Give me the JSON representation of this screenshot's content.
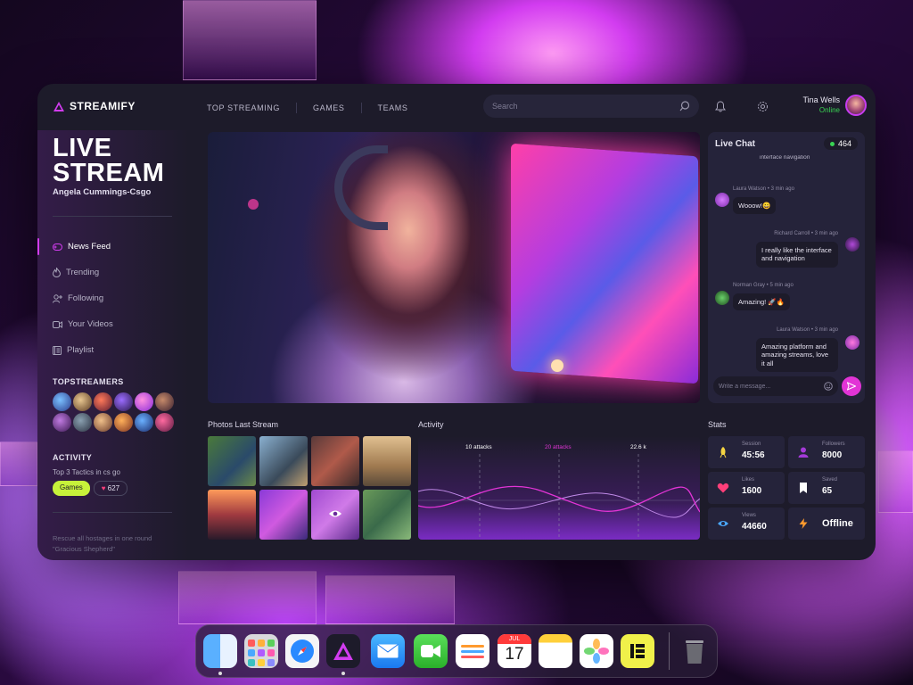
{
  "brand": {
    "name": "STREAMIFY",
    "accent": "#d23cf0"
  },
  "nav": {
    "items": [
      "TOP STREAMING",
      "GAMES",
      "TEAMS"
    ]
  },
  "search": {
    "placeholder": "Search"
  },
  "user": {
    "name": "Tina Wells",
    "status": "Online"
  },
  "sidebar": {
    "title_line1": "LIVE",
    "title_line2": "STREAM",
    "subtitle": "Angela Cummings-Csgo",
    "menu": [
      {
        "label": "News Feed",
        "icon": "gamepad-icon",
        "active": true
      },
      {
        "label": "Trending",
        "icon": "flame-icon"
      },
      {
        "label": "Following",
        "icon": "user-plus-icon"
      },
      {
        "label": "Your Videos",
        "icon": "video-icon"
      },
      {
        "label": "Playlist",
        "icon": "playlist-icon"
      }
    ],
    "topstreamers_label": "TOPSTREAMERS",
    "activity_label": "ACTIVITY",
    "activity_text": "Top 3 Tactics in cs go",
    "tag_games": "Games",
    "tag_count": "627",
    "footer_text1": "Rescue all hostages in one round",
    "footer_text2": "\"Gracious Shepherd\""
  },
  "chat": {
    "title": "Live Chat",
    "count": "464",
    "top_cut": "interface navigation",
    "messages": [
      {
        "meta": "Laura Watson • 3 min ago",
        "text": "Wooow!😀",
        "side": "left"
      },
      {
        "meta": "Richard Carroll • 3 min ago",
        "text": "I really like the interface and navigation",
        "side": "right"
      },
      {
        "meta": "Norman Gray • 5 min ago",
        "text": "Amazing! 🚀🔥",
        "side": "left"
      },
      {
        "meta": "Laura Watson • 3 min ago",
        "text": "Amazing platform and amazing streams, love it all",
        "side": "right"
      }
    ],
    "input_placeholder": "Write a message..."
  },
  "photos": {
    "title": "Photos Last Stream"
  },
  "activity": {
    "title": "Activity",
    "labels": [
      "10 attacks",
      "20 attacks",
      "22.6 k"
    ],
    "highlight_color": "#e234d6"
  },
  "stats": {
    "title": "Stats",
    "items": [
      {
        "label": "Session",
        "value": "45:56",
        "icon": "rocket-icon",
        "color": "#f5d442"
      },
      {
        "label": "Followers",
        "value": "8000",
        "icon": "user-icon",
        "color": "#a43ad8"
      },
      {
        "label": "Likes",
        "value": "1600",
        "icon": "heart-icon",
        "color": "#ff3f7a"
      },
      {
        "label": "Saved",
        "value": "65",
        "icon": "bookmark-icon",
        "color": "#ffffff"
      },
      {
        "label": "Views",
        "value": "44660",
        "icon": "eye-icon",
        "color": "#4aa8ff"
      },
      {
        "label": "",
        "value": "Offline",
        "icon": "bolt-icon",
        "color": "#ff9a2e"
      }
    ]
  },
  "dock": {
    "calendar_month": "JUL",
    "calendar_day": "17",
    "apps": [
      "finder-icon",
      "launchpad-icon",
      "safari-icon",
      "streamify-icon",
      "mail-icon",
      "facetime-icon",
      "reminders-icon",
      "calendar-icon",
      "notes-icon",
      "photos-icon",
      "elementor-icon",
      "trash-icon"
    ]
  }
}
